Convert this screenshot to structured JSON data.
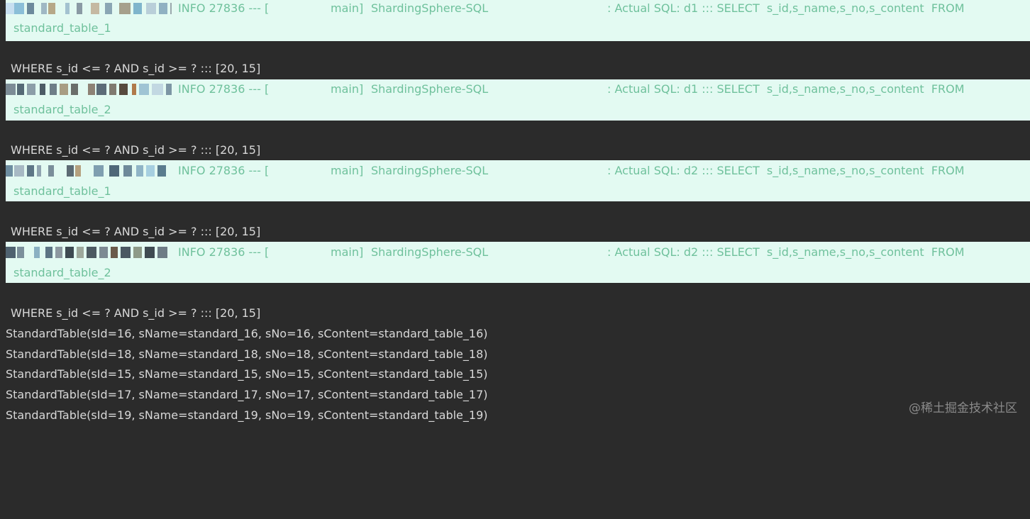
{
  "log_entries": [
    {
      "level": "INFO 27836 --- [",
      "thread": "main]",
      "logger": "ShardingSphere-SQL",
      "message": ": Actual SQL: d1 ::: SELECT  s_id,s_name,s_no,s_content  FROM",
      "continuation": "standard_table_1",
      "where": "WHERE s_id <= ? AND s_id >= ? ::: [20, 15]"
    },
    {
      "level": "INFO 27836 --- [",
      "thread": "main]",
      "logger": "ShardingSphere-SQL",
      "message": ": Actual SQL: d1 ::: SELECT  s_id,s_name,s_no,s_content  FROM",
      "continuation": "standard_table_2",
      "where": "WHERE s_id <= ? AND s_id >= ? ::: [20, 15]"
    },
    {
      "level": "INFO 27836 --- [",
      "thread": "main]",
      "logger": "ShardingSphere-SQL",
      "message": ": Actual SQL: d2 ::: SELECT  s_id,s_name,s_no,s_content  FROM",
      "continuation": "standard_table_1",
      "where": "WHERE s_id <= ? AND s_id >= ? ::: [20, 15]"
    },
    {
      "level": "INFO 27836 --- [",
      "thread": "main]",
      "logger": "ShardingSphere-SQL",
      "message": ": Actual SQL: d2 ::: SELECT  s_id,s_name,s_no,s_content  FROM",
      "continuation": "standard_table_2",
      "where": "WHERE s_id <= ? AND s_id >= ? ::: [20, 15]"
    }
  ],
  "results": [
    "StandardTable(sId=16, sName=standard_16, sNo=16, sContent=standard_table_16)",
    "StandardTable(sId=18, sName=standard_18, sNo=18, sContent=standard_table_18)",
    "StandardTable(sId=15, sName=standard_15, sNo=15, sContent=standard_table_15)",
    "StandardTable(sId=17, sName=standard_17, sNo=17, sContent=standard_table_17)",
    "StandardTable(sId=19, sName=standard_19, sNo=19, sContent=standard_table_19)"
  ],
  "watermark": "@稀土掘金技术社区",
  "colors": {
    "background": "#2b2b2b",
    "log_highlight_bg": "#e3faf2",
    "log_text": "#6fc19c",
    "plain_text": "#d8d8d8",
    "watermark": "#8a8a8a"
  }
}
